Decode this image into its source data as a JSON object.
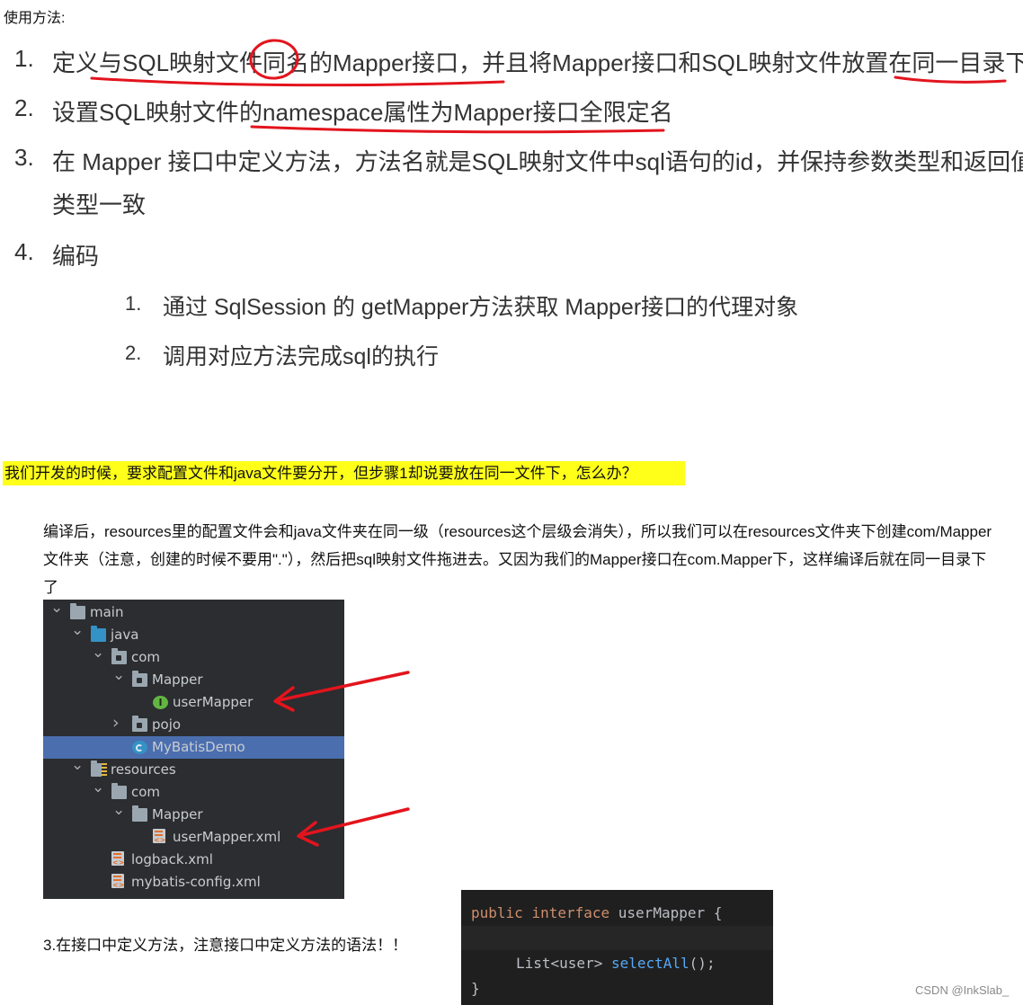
{
  "usage_label": "使用方法:",
  "steps": [
    {
      "num": "1.",
      "text": "定义与SQL映射文件同名的Mapper接口，并且将Mapper接口和SQL映射文件放置在同一目录下"
    },
    {
      "num": "2.",
      "text": "设置SQL映射文件的namespace属性为Mapper接口全限定名"
    },
    {
      "num": "3.",
      "text": "在 Mapper 接口中定义方法，方法名就是SQL映射文件中sql语句的id，并保持参数类型和返回值",
      "text2": "类型一致"
    },
    {
      "num": "4.",
      "text": "编码"
    }
  ],
  "substeps": [
    {
      "num": "1.",
      "text": "通过 SqlSession 的 getMapper方法获取 Mapper接口的代理对象"
    },
    {
      "num": "2.",
      "text": "调用对应方法完成sql的执行"
    }
  ],
  "question": "我们开发的时候，要求配置文件和java文件要分开，但步骤1却说要放在同一文件下，怎么办？",
  "answer": "编译后，resources里的配置文件会和java文件夹在同一级（resources这个层级会消失），所以我们可以在resources文件夹下创建com/Mapper文件夹（注意，创建的时候不要用\".\"），然后把sql映射文件拖进去。又因为我们的Mapper接口在com.Mapper下，这样编译后就在同一目录下了",
  "tree": {
    "rows": [
      {
        "label": "main",
        "icon": "folder-icon",
        "chev": "v",
        "indent": 0
      },
      {
        "label": "java",
        "icon": "source-folder-icon",
        "chev": "v",
        "indent": 1
      },
      {
        "label": "com",
        "icon": "package-icon",
        "chev": "v",
        "indent": 2
      },
      {
        "label": "Mapper",
        "icon": "package-icon",
        "chev": "v",
        "indent": 3
      },
      {
        "label": "userMapper",
        "icon": "interface-icon",
        "chev": "",
        "indent": 4
      },
      {
        "label": "pojo",
        "icon": "package-icon",
        "chev": ">",
        "indent": 3
      },
      {
        "label": "MyBatisDemo",
        "icon": "class-icon",
        "chev": "",
        "indent": 3,
        "selected": true
      },
      {
        "label": "resources",
        "icon": "resources-folder-icon",
        "chev": "v",
        "indent": 1
      },
      {
        "label": "com",
        "icon": "folder-icon",
        "chev": "v",
        "indent": 2
      },
      {
        "label": "Mapper",
        "icon": "folder-icon",
        "chev": "v",
        "indent": 3
      },
      {
        "label": "userMapper.xml",
        "icon": "xml-file-icon",
        "chev": "",
        "indent": 4
      },
      {
        "label": "logback.xml",
        "icon": "xml-file-icon",
        "chev": "",
        "indent": 2
      },
      {
        "label": "mybatis-config.xml",
        "icon": "xml-file-icon",
        "chev": "",
        "indent": 2
      }
    ]
  },
  "step3_label": "3.在接口中定义方法，注意接口中定义方法的语法！！",
  "code": {
    "kw_public": "public",
    "kw_interface": "interface",
    "name": "userMapper",
    "open_brace": "{",
    "return_type": "List<user>",
    "method": "selectAll",
    "parens": "();",
    "close_brace": "}"
  },
  "watermark": "CSDN @InkSlab_",
  "colors": {
    "highlight": "#ffff1a",
    "annotation_red": "#e3141d",
    "ide_bg": "#2b2d30",
    "selected_row": "#4b6eaf"
  }
}
